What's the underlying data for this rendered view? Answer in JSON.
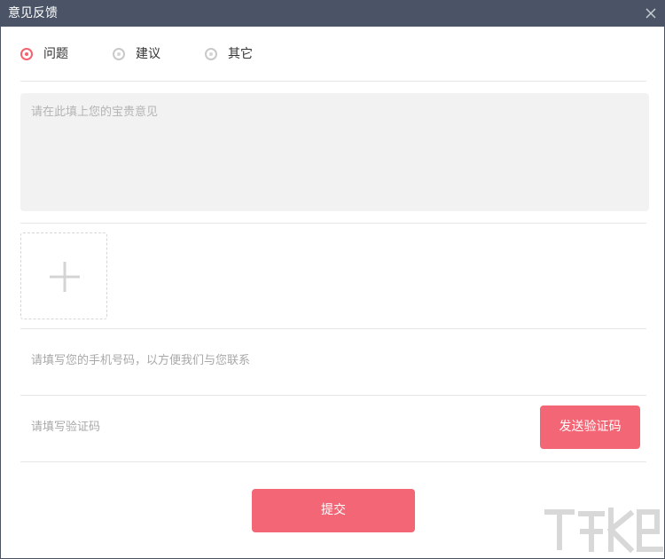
{
  "window": {
    "title": "意见反馈"
  },
  "feedback_type": {
    "options": [
      {
        "label": "问题",
        "checked": true
      },
      {
        "label": "建议",
        "checked": false
      },
      {
        "label": "其它",
        "checked": false
      }
    ]
  },
  "content": {
    "placeholder": "请在此填上您的宝贵意见"
  },
  "phone": {
    "placeholder": "请填写您的手机号码，以方便我们与您联系"
  },
  "code": {
    "placeholder": "请填写验证码",
    "send_label": "发送验证码"
  },
  "submit": {
    "label": "提交"
  },
  "colors": {
    "titlebar": "#4a5466",
    "accent": "#f26675",
    "textarea_bg": "#f2f2f2"
  }
}
